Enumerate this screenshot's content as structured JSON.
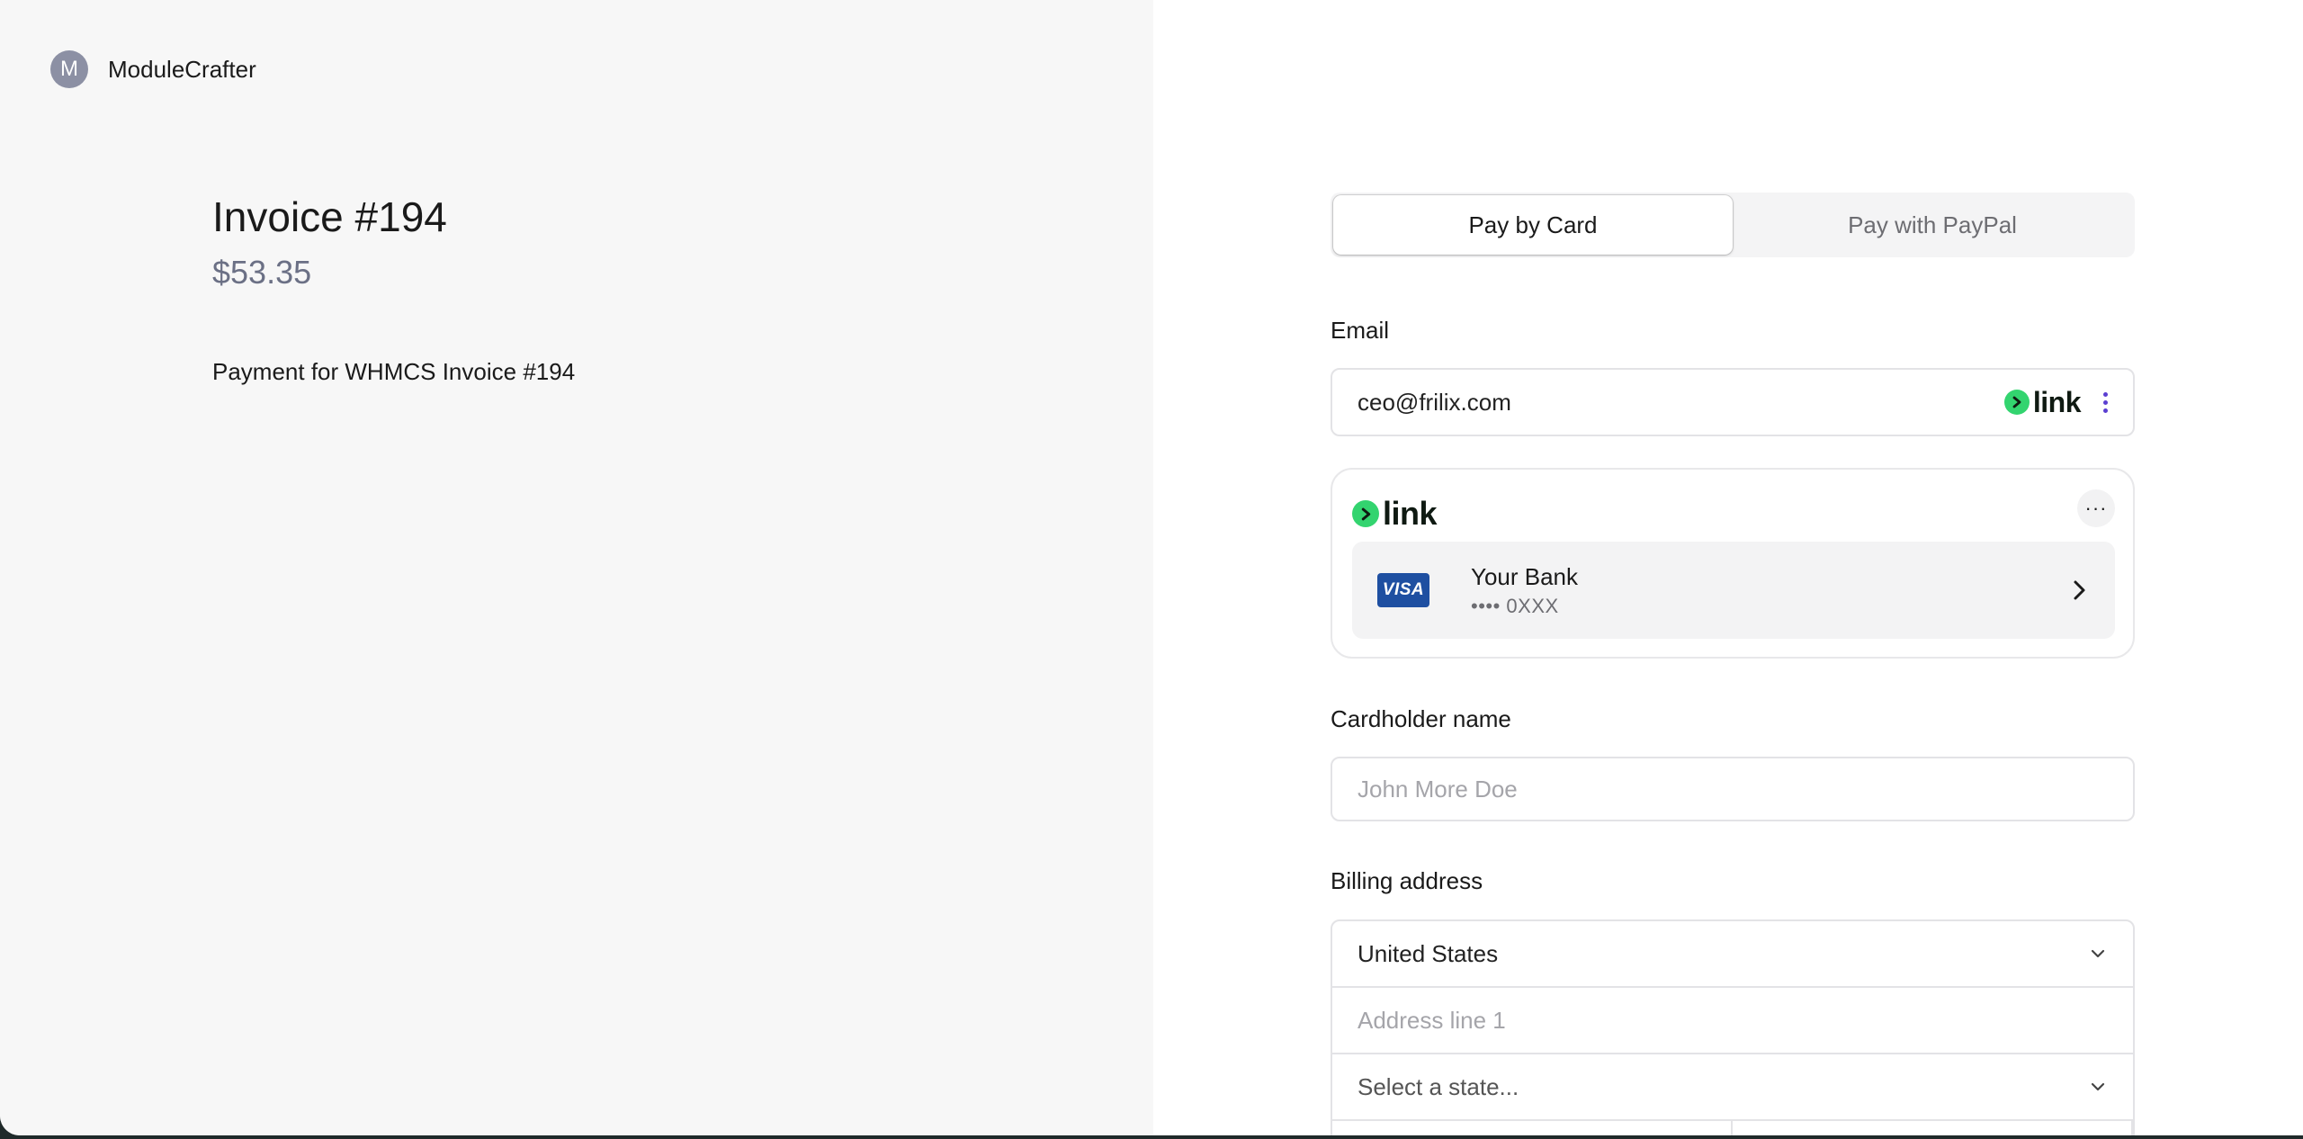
{
  "brand": {
    "initial": "M",
    "name": "ModuleCrafter"
  },
  "invoice": {
    "title": "Invoice #194",
    "amount": "$53.35",
    "description": "Payment for WHMCS Invoice #194"
  },
  "tabs": [
    {
      "label": "Pay by Card",
      "active": true
    },
    {
      "label": "Pay with PayPal",
      "active": false
    }
  ],
  "email": {
    "label": "Email",
    "value": "ceo@frilix.com",
    "link_text": "link"
  },
  "link_card": {
    "logo_text": "link",
    "more_label": "···",
    "bank_name": "Your Bank",
    "card_brand": "VISA",
    "card_number": "•••• 0XXX"
  },
  "cardholder": {
    "label": "Cardholder name",
    "placeholder": "John More Doe"
  },
  "billing": {
    "label": "Billing address",
    "country": "United States",
    "address_placeholder": "Address line 1",
    "state_placeholder": "Select a state..."
  },
  "colors": {
    "left_panel_bg": "#f7f7f7",
    "link_green": "#33d46f",
    "visa_blue": "#1e4fa1",
    "kebab_purple": "#5b3fd1"
  }
}
